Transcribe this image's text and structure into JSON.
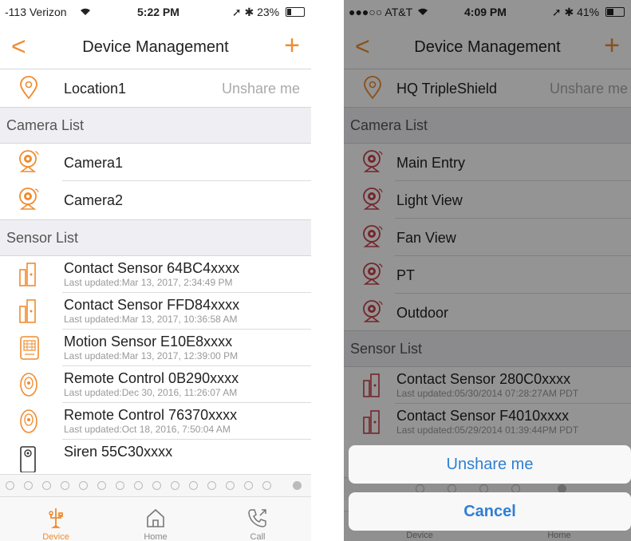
{
  "left": {
    "status": {
      "carrier": "-113 Verizon",
      "time": "5:22 PM",
      "battery": "23%",
      "battery_level": 0.23
    },
    "nav": {
      "back": "<",
      "title": "Device Management",
      "add": "+"
    },
    "location": {
      "name": "Location1",
      "action": "Unshare me"
    },
    "camera_header": "Camera List",
    "cameras": [
      {
        "name": "Camera1"
      },
      {
        "name": "Camera2"
      }
    ],
    "sensor_header": "Sensor List",
    "sensors": [
      {
        "name": "Contact Sensor 64BC4xxxx",
        "updated": "Last updated:Mar 13, 2017, 2:34:49 PM",
        "icon": "contact-sensor-icon"
      },
      {
        "name": "Contact Sensor FFD84xxxx",
        "updated": "Last updated:Mar 13, 2017, 10:36:58 AM",
        "icon": "contact-sensor-icon"
      },
      {
        "name": "Motion Sensor E10E8xxxx",
        "updated": "Last updated:Mar 13, 2017, 12:39:00 PM",
        "icon": "motion-sensor-icon"
      },
      {
        "name": "Remote Control 0B290xxxx",
        "updated": "Last updated:Dec 30, 2016, 11:26:07 AM",
        "icon": "remote-control-icon"
      },
      {
        "name": "Remote Control 76370xxxx",
        "updated": "Last updated:Oct 18, 2016, 7:50:04 AM",
        "icon": "remote-control-icon"
      },
      {
        "name": "Siren 55C30xxxx",
        "updated": "",
        "icon": "siren-icon"
      }
    ],
    "tabs": [
      {
        "label": "Device"
      },
      {
        "label": "Home"
      },
      {
        "label": "Call"
      }
    ]
  },
  "right": {
    "status": {
      "carrier": "●●●○○ AT&T",
      "time": "4:09 PM",
      "battery": "41%",
      "battery_level": 0.41
    },
    "nav": {
      "back": "<",
      "title": "Device Management",
      "add": "+"
    },
    "location": {
      "name": "HQ TripleShield",
      "action": "Unshare me"
    },
    "camera_header": "Camera List",
    "cameras": [
      {
        "name": "Main Entry"
      },
      {
        "name": "Light View"
      },
      {
        "name": "Fan View"
      },
      {
        "name": "PT"
      },
      {
        "name": "Outdoor"
      }
    ],
    "sensor_header": "Sensor List",
    "sensors": [
      {
        "name": "Contact Sensor 280C0xxxx",
        "updated": "Last updated:05/30/2014 07:28:27AM PDT"
      },
      {
        "name": "Contact Sensor F4010xxxx",
        "updated": "Last updated:05/29/2014 01:39:44PM PDT"
      }
    ],
    "sheet": {
      "unshare": "Unshare me",
      "cancel": "Cancel"
    },
    "tabs": [
      {
        "label": "Device"
      },
      {
        "label": "Home"
      }
    ]
  },
  "colors": {
    "accent": "#f08c30",
    "ios_blue": "#2f7fd4",
    "camera_red": "#c9424a"
  }
}
